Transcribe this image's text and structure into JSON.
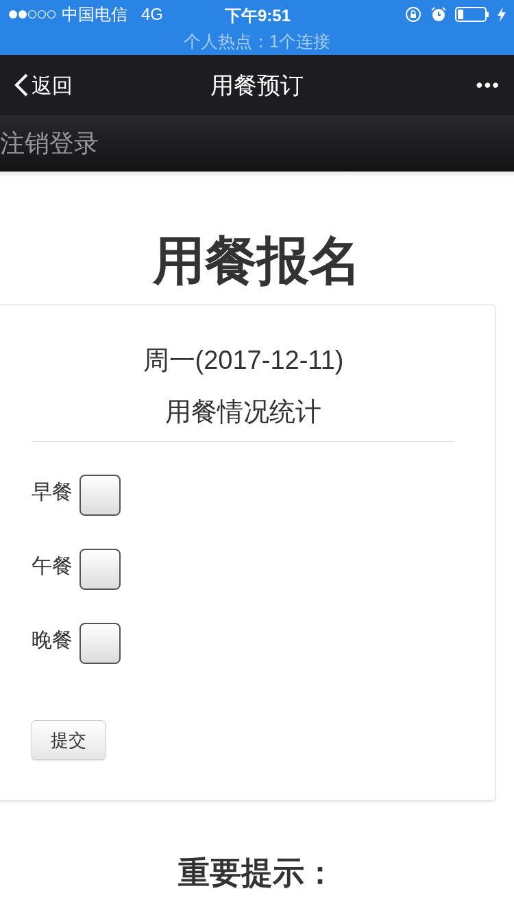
{
  "status_bar": {
    "carrier": "中国电信",
    "network": "4G",
    "time": "下午9:51",
    "hotspot": "个人热点：1个连接"
  },
  "nav_bar": {
    "back": "返回",
    "title": "用餐预订",
    "more": "•••"
  },
  "sub_bar": {
    "logout": "注销登录"
  },
  "page_title": "用餐报名",
  "card": {
    "date": "周一(2017-12-11)",
    "subtitle": "用餐情况统计",
    "meals": [
      {
        "label": "早餐",
        "checked": false
      },
      {
        "label": "午餐",
        "checked": false
      },
      {
        "label": "晚餐",
        "checked": false
      }
    ],
    "submit": "提交"
  },
  "notice_title": "重要提示："
}
